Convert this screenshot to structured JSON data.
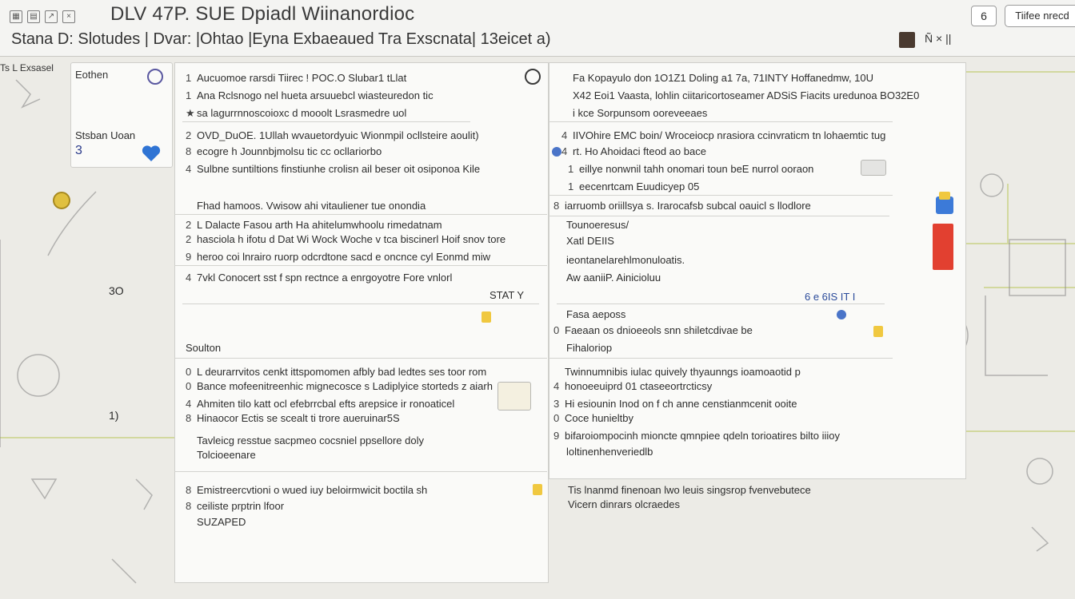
{
  "header": {
    "title": "DLV 47P.  SUE  Dpiadl Wiinanordioc",
    "subtitle": "Stana  D:  Slotudes  |  Dvar:   |Ohtao  |Eyna Exbaeaued Tra Exscnata|  13eicet a)",
    "square_button": "6",
    "right_button": "Tiifee nrecd",
    "controls": "Ñ × ||"
  },
  "left": {
    "label": "Ts  L Exsasel",
    "card_item": "Eothen",
    "card_status": "Stsban  Uoan",
    "card_num": "3",
    "side_num1": "3O",
    "side_num2": "1)"
  },
  "left_panel": {
    "rows": [
      {
        "n": "1",
        "text": "Aucuomoe rarsdi Tiirec  !  POC.O  Slubar1 tLlat"
      },
      {
        "n": "1",
        "text": "Ana Rclsnogo nel hueta  arsuuebcl wiasteuredon tic"
      },
      {
        "n": "★",
        "text": "sa lagurrnnoscoioxc d mooolt Lsrasmedre uol"
      },
      {
        "n": "2",
        "text": "OVD_DuOE. 1Ullah wvauetordyuic  Wionmpil ocllsteire aoulit)"
      },
      {
        "n": "8",
        "text": "ecogre  h Jounnbjmolsu tic cc ocllariorbo"
      },
      {
        "n": "4",
        "text": "Sulbne suntiltions finstiunhe crolisn ail beser oit osiponoa Kile"
      },
      {
        "n": "",
        "text": "Fhad hamoos.  Vwisow  ahi vitauliener tue onondia"
      },
      {
        "n": "2",
        "text": "L Dalacte    Fasou arth Ha ahitelumwhoolu rimedatnam"
      },
      {
        "n": "2",
        "text": "hasciola h ifotu d Dat  Wi Wock  Woche v tca biscinerl Hoif  snov tore"
      },
      {
        "n": "9",
        "text": "heroo coi lnrairo ruorp  odcrdtone sacd e oncnce cyl Eonmd miw"
      },
      {
        "n": "4",
        "text": "7vkl  Conocert sst  f spn  rectnce  a  enrgoyotre  Fore  vnlorl"
      },
      {
        "n": "",
        "text": "STAT   Y"
      },
      {
        "n": "",
        "text": "Soulton"
      },
      {
        "n": "0",
        "text": "L deurarrvitos   cenkt ittspomomen afbly bad ledtes ses toor rom"
      },
      {
        "n": "0",
        "text": "Bance mofeenitreenhic mignecosce s  Ladiplyice storteds z  aiarh"
      },
      {
        "n": "4",
        "text": "Ahmiten tilo katt ocl efebrrcbal efts arepsice ir ronoaticel"
      },
      {
        "n": "8",
        "text": "Hinaocor Ectis se scealt ti trore  aueruinar5S"
      },
      {
        "n": "",
        "text": "Tavleicg resstue sacpmeo cocsniel ppsellore doly"
      },
      {
        "n": "",
        "text": "Tolcioeenare"
      },
      {
        "n": "8",
        "text": "Emistreercvtioni o wued  iuy beloirmwicit  boctila sh"
      },
      {
        "n": "8",
        "text": "ceiliste prptrin lfoor"
      },
      {
        "n": "",
        "text": "SUZAPED"
      }
    ]
  },
  "right_panel": {
    "rows": [
      {
        "n": "",
        "text": "Fa  Kopayulo don  1O1Z1 Doling  a1 7a,  71INTY  Hoffanedmw,  10U"
      },
      {
        "n": "",
        "text": "X42  Eoi1 Vaasta, lohlin  ciitaricortoseamer  ADSiS  Fiacits uredunoa  BO32E0"
      },
      {
        "n": "",
        "text": "i kce  Sorpunsom ooreveeaes"
      },
      {
        "n": "4",
        "text": "IIVOhire  EMC  boin/ Wroceiocp  nrasiora  ccinvraticm  tn  lohaemtic  tug"
      },
      {
        "n": "4",
        "text": "rt. Ho  Ahoidaci fteod ao bace"
      },
      {
        "n": "1",
        "text": "eillye nonwnil tahh onomari  toun beE nurrol ooraon"
      },
      {
        "n": "1",
        "text": "eecenrtcam  Euudicyep 05"
      },
      {
        "n": "8",
        "text": "iarruomb  oriillsya  s. Irarocafsb subcal oauicl s llodlore"
      },
      {
        "n": "",
        "text": "Tounoeresus/"
      },
      {
        "n": "",
        "text": "Xatl DEIIS"
      },
      {
        "n": "",
        "text": "ieontanelarehlmonuloatis."
      },
      {
        "n": "",
        "text": "Aw  aaniiP.  Ainicioluu"
      },
      {
        "n": "",
        "text": "6  e 6IS IT I"
      },
      {
        "n": "",
        "text": "Fasa aeposs"
      },
      {
        "n": "0",
        "text": "Faeaan os dnioeeols snn shiletcdivae be"
      },
      {
        "n": "",
        "text": "Fihaloriop"
      },
      {
        "n": "",
        "text": "Twinnumnibis iulac quively thyaunngs  ioamoaotid p"
      },
      {
        "n": "4",
        "text": "honoeeuiprd       01  ctaseeortrcticsy"
      },
      {
        "n": "3",
        "text": "Hi esiounin Inod on  f ch anne censtianmcenit ooite"
      },
      {
        "n": "0",
        "text": "Coce hunieltby"
      },
      {
        "n": "9",
        "text": "bifaroiompocinh mioncte qmnpiee qdeln torioatires  bilto iiioy"
      },
      {
        "n": "",
        "text": "loltinenhenveriedlb"
      },
      {
        "n": "",
        "text": "Tis lnanmd finenoan  lwo leuis  singsrop fvenvebutece"
      },
      {
        "n": "",
        "text": "Vicern dinrars olcraedes"
      }
    ]
  },
  "colors": {
    "accent_blue": "#4a74c8",
    "heart_blue": "#2f74d4",
    "alert_red": "#e24030",
    "highlight_yellow": "#f0c840",
    "background": "#ecebe6"
  },
  "icons": [
    "grid-icon",
    "file-icon",
    "arrow-icon",
    "close-icon",
    "heart-icon",
    "coin-icon",
    "target-icon",
    "shield-icon",
    "folder-icon",
    "phone-icon"
  ]
}
